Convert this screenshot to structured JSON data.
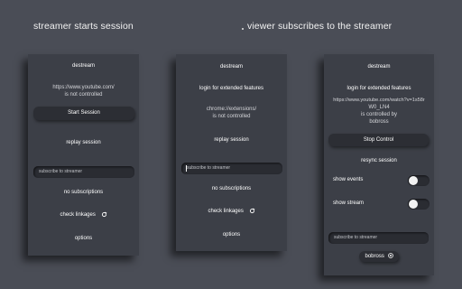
{
  "headings": {
    "left": "streamer starts session",
    "right": "viewer subscribes to the streamer"
  },
  "panel1": {
    "title": "destream",
    "url": "https://www.youtube.com/",
    "status": "is not controlled",
    "start_button": "Start Session",
    "replay": "replay session",
    "input_value": "subscribe to streamer",
    "no_subs": "no subscriptions",
    "check": "check linkages",
    "options": "options"
  },
  "panel2": {
    "title": "destream",
    "login": "login for extended features",
    "url": "chrome://extensions/",
    "status": "is not controlled",
    "replay": "replay session",
    "input_placeholder": "subscribe to streamer",
    "no_subs": "no subscriptions",
    "check": "check linkages",
    "options": "options"
  },
  "panel3": {
    "title": "destream",
    "login": "login for extended features",
    "url_line1": "https://www.youtube.com/watch?v=1s58r",
    "url_line2": "W0_LN4",
    "controlled": "is controlled by",
    "controller": "bobross",
    "stop_button": "Stop Control",
    "resync": "resync session",
    "show_events": "show events",
    "show_stream": "show stream",
    "input_value": "subscribe to streamer",
    "sub_chip": "bobross"
  },
  "icons": {
    "refresh": "refresh-icon",
    "close": "close-circle-icon"
  }
}
